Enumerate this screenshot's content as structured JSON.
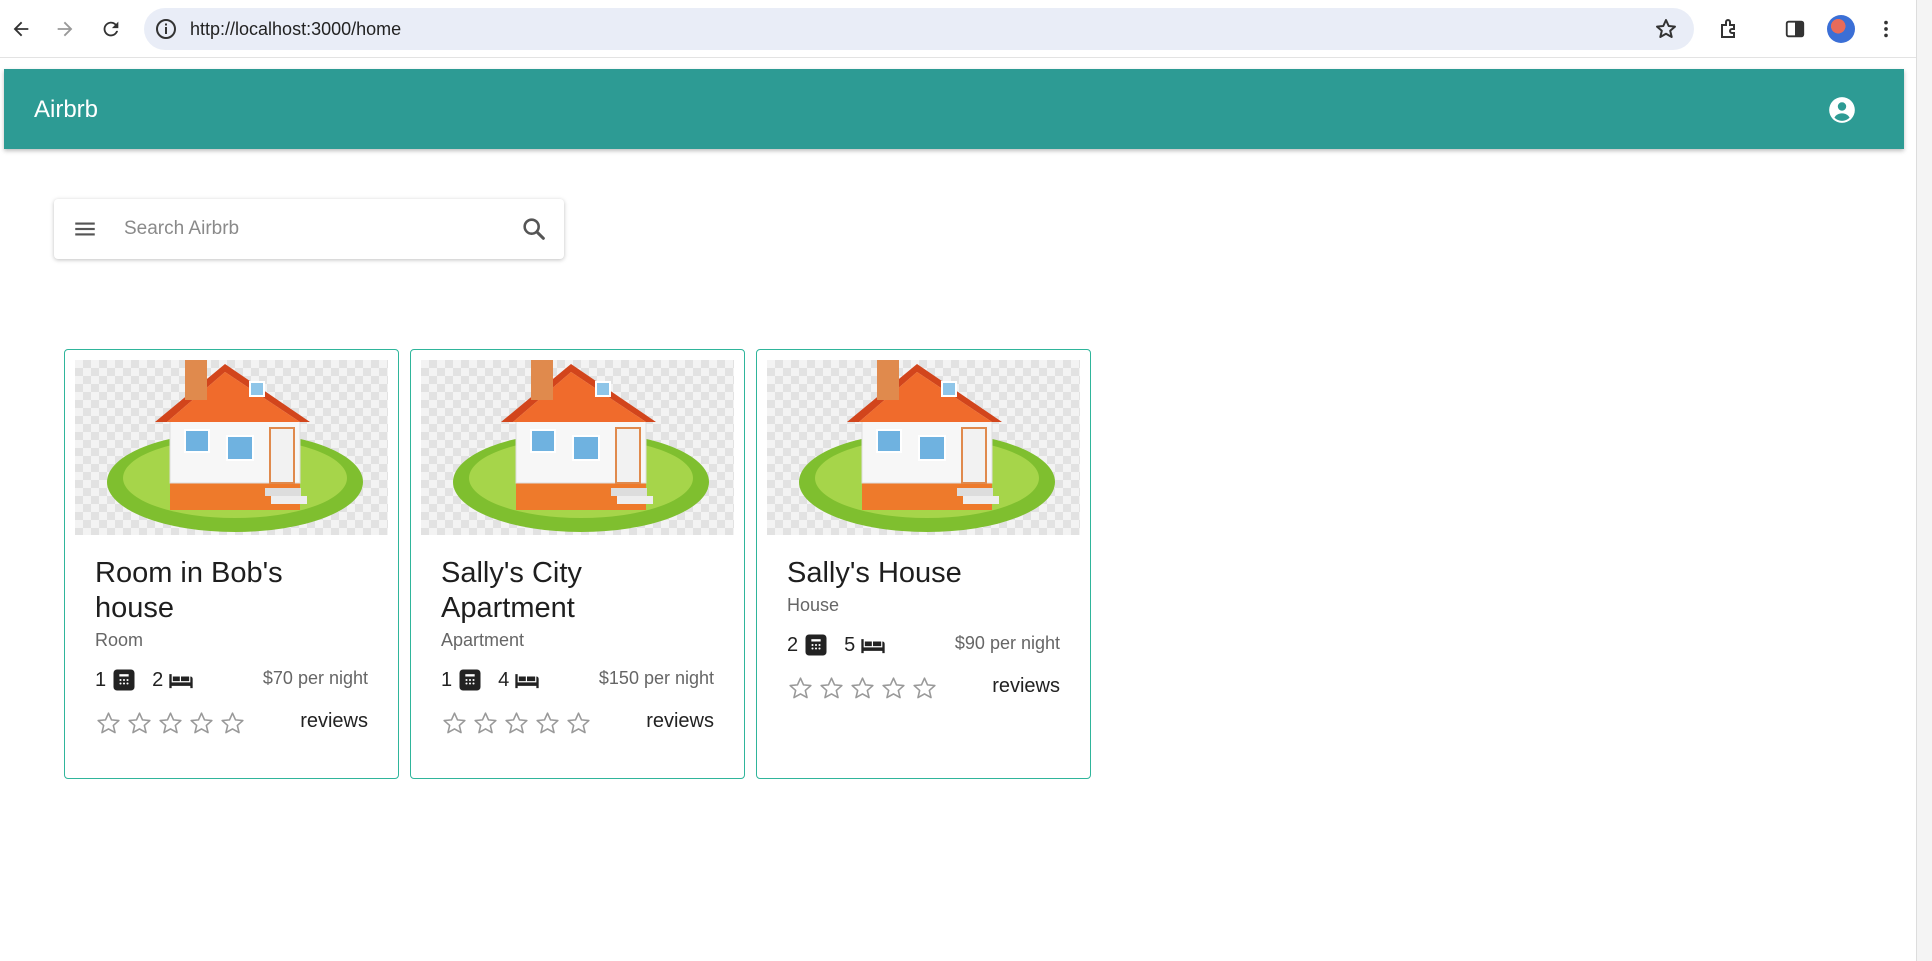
{
  "browser": {
    "url": "http://localhost:3000/home"
  },
  "appbar": {
    "title": "Airbrb"
  },
  "search": {
    "placeholder": "Search Airbrb"
  },
  "listings": [
    {
      "title": "Room in Bob's house",
      "type": "Room",
      "bathrooms": "1",
      "beds": "2",
      "price": "$70 per night",
      "rating_stars": 0,
      "reviews_label": "reviews"
    },
    {
      "title": "Sally's City Apartment",
      "type": "Apartment",
      "bathrooms": "1",
      "beds": "4",
      "price": "$150 per night",
      "rating_stars": 0,
      "reviews_label": "reviews"
    },
    {
      "title": "Sally's House",
      "type": "House",
      "bathrooms": "2",
      "beds": "5",
      "price": "$90 per night",
      "rating_stars": 0,
      "reviews_label": "reviews"
    }
  ],
  "colors": {
    "appbar": "#2d9b94",
    "card_border": "#2fb59b"
  }
}
